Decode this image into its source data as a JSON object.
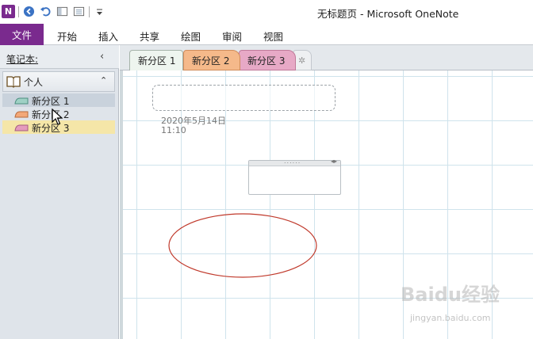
{
  "window": {
    "title": "无标题页 - Microsoft OneNote"
  },
  "ribbon": {
    "file_label": "文件",
    "tabs": [
      "开始",
      "插入",
      "共享",
      "绘图",
      "审阅",
      "视图"
    ]
  },
  "navigation": {
    "header_label": "笔记本:",
    "notebook_name": "个人",
    "sections": [
      {
        "label": "新分区 1",
        "color": "#9fd1c5"
      },
      {
        "label": "新分区 2",
        "color": "#f3a878"
      },
      {
        "label": "新分区 3",
        "color": "#e59bbd"
      }
    ]
  },
  "section_tabs": [
    {
      "label": "新分区 1",
      "color": "#eef5ef"
    },
    {
      "label": "新分区 2",
      "color": "#f5b98a"
    },
    {
      "label": "新分区 3",
      "color": "#e7a9c6"
    },
    {
      "label": "✲"
    }
  ],
  "page": {
    "date": "2020年5月14日",
    "time": "11:10"
  },
  "watermark": {
    "brand": "Baidu经验",
    "url": "jingyan.baidu.com"
  },
  "colors": {
    "accent": "#7a2a8e",
    "ellipse_stroke": "#c0392b",
    "grid": "#cfe3ec"
  }
}
